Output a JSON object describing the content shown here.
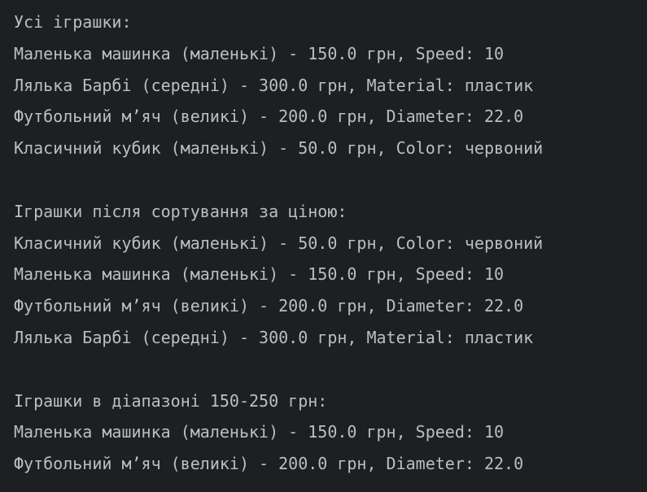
{
  "console": {
    "sections": [
      {
        "header": "Усі іграшки:",
        "lines": [
          "Маленька машинка (маленькі) - 150.0 грн, Speed: 10",
          "Лялька Барбі (середні) - 300.0 грн, Material: пластик",
          "Футбольний м’яч (великі) - 200.0 грн, Diameter: 22.0",
          "Класичний кубик (маленькі) - 50.0 грн, Color: червоний"
        ]
      },
      {
        "header": "Іграшки після сортування за ціною:",
        "lines": [
          "Класичний кубик (маленькі) - 50.0 грн, Color: червоний",
          "Маленька машинка (маленькі) - 150.0 грн, Speed: 10",
          "Футбольний м’яч (великі) - 200.0 грн, Diameter: 22.0",
          "Лялька Барбі (середні) - 300.0 грн, Material: пластик"
        ]
      },
      {
        "header": "Іграшки в діапазоні 150-250 грн:",
        "lines": [
          "Маленька машинка (маленькі) - 150.0 грн, Speed: 10",
          "Футбольний м’яч (великі) - 200.0 грн, Diameter: 22.0"
        ]
      }
    ]
  }
}
